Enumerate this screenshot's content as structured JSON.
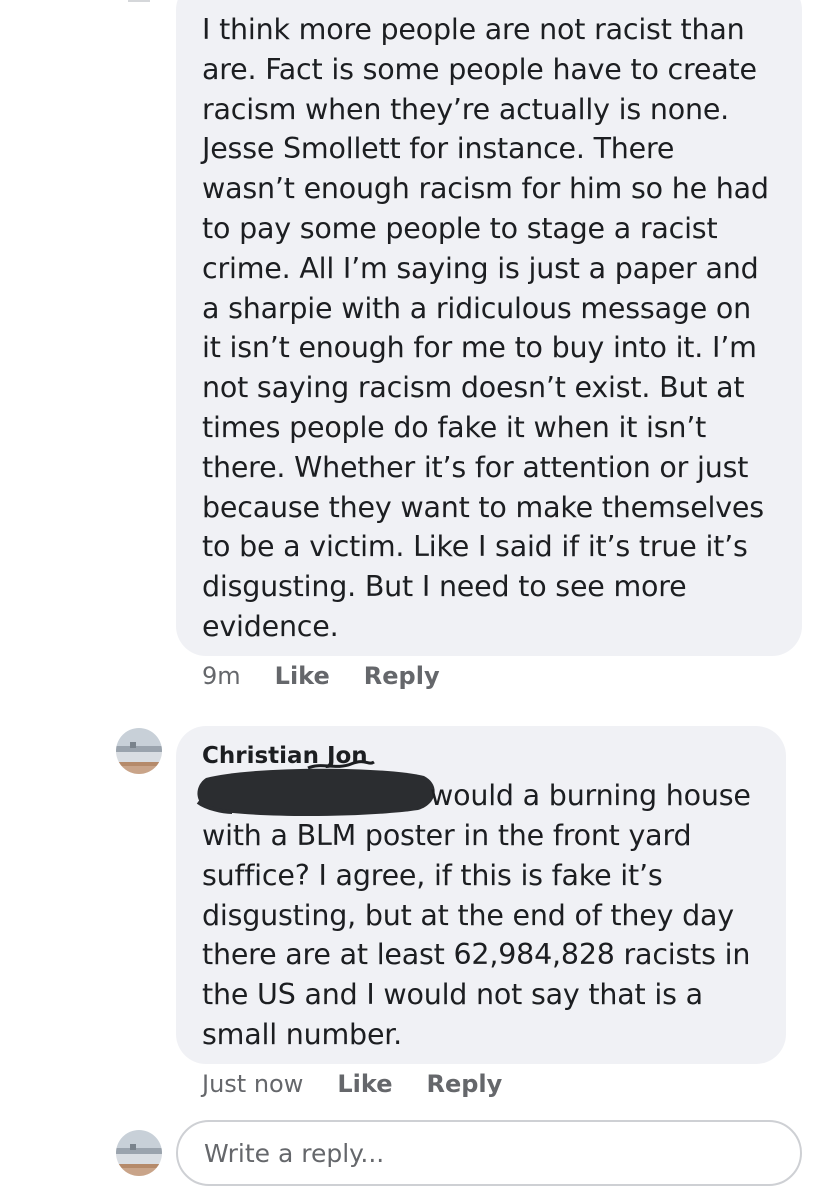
{
  "comments": [
    {
      "text": "I think more people are not racist than\nare.  Fact is some people have to create\nracism when they’re actually is none.\nJesse Smollett for instance. There\nwasn’t enough racism for him so he had\nto pay some people to stage a racist\ncrime. All I’m saying is just a paper and\na sharpie with a ridiculous message on\nit isn’t enough for me to buy into it. I’m\nnot saying racism doesn’t exist. But at\ntimes people do fake it when it isn’t\nthere. Whether it’s for attention or just\nbecause they want to make themselves\nto be a victim. Like I said if it’s true it’s\ndisgusting. But I need to see more\nevidence.",
      "time": "9m",
      "like_label": "Like",
      "reply_label": "Reply"
    },
    {
      "author": "Christian Jon",
      "first_line": "would a burning house",
      "text": "with a BLM poster in the front yard\nsuffice? I agree, if this is fake it’s\ndisgusting, but at the end of they day\nthere are at least 62,984,828 racists in\nthe US and I would not say that is a\nsmall number.",
      "time": "Just now",
      "like_label": "Like",
      "reply_label": "Reply"
    }
  ],
  "reply_input": {
    "placeholder": "Write a reply..."
  },
  "colors": {
    "bubble": "#f0f1f5",
    "meta_text": "#65676b",
    "redaction": "#2b2d30"
  }
}
